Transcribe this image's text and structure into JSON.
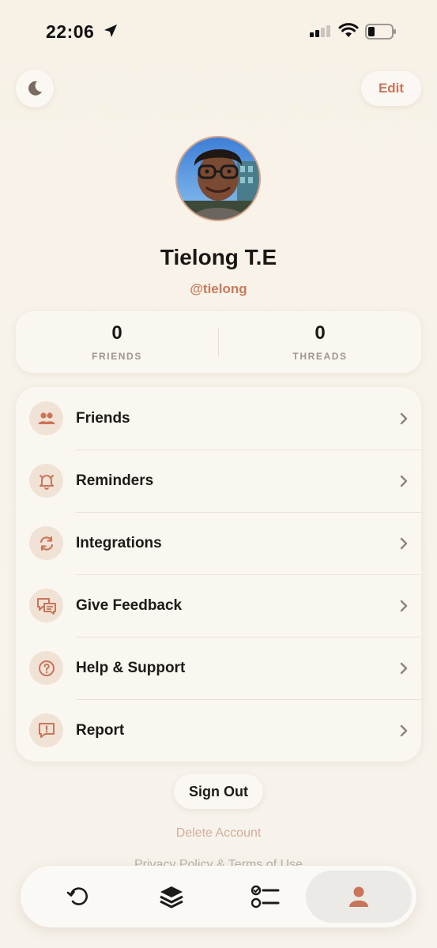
{
  "status_bar": {
    "time": "22:06"
  },
  "header": {
    "edit_label": "Edit"
  },
  "profile": {
    "name": "Tielong T.E",
    "handle": "@tielong"
  },
  "stats": [
    {
      "value": "0",
      "label": "FRIENDS"
    },
    {
      "value": "0",
      "label": "THREADS"
    }
  ],
  "menu": [
    {
      "label": "Friends",
      "icon": "friends-icon"
    },
    {
      "label": "Reminders",
      "icon": "bell-icon"
    },
    {
      "label": "Integrations",
      "icon": "sync-icon"
    },
    {
      "label": "Give Feedback",
      "icon": "feedback-icon"
    },
    {
      "label": "Help & Support",
      "icon": "question-icon"
    },
    {
      "label": "Report",
      "icon": "report-icon"
    }
  ],
  "actions": {
    "sign_out": "Sign Out",
    "delete_account": "Delete Account",
    "privacy": "Privacy Policy & Terms of Use"
  },
  "tabs": [
    {
      "icon": "history-icon",
      "active": false
    },
    {
      "icon": "layers-icon",
      "active": false
    },
    {
      "icon": "checklist-icon",
      "active": false
    },
    {
      "icon": "profile-icon",
      "active": true
    }
  ],
  "colors": {
    "accent": "#c8755a",
    "background": "#f8f3ea",
    "card": "#faf7f1",
    "icon_bg": "#f1e2d6"
  }
}
